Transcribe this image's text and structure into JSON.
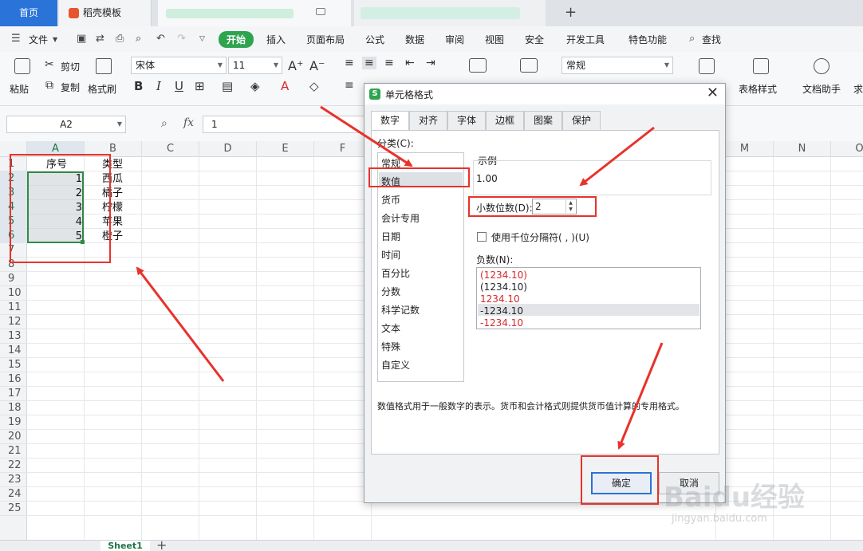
{
  "tabs": {
    "home": "首页",
    "template": "稻壳模板",
    "new_tab": "+"
  },
  "menu": {
    "file": "文件",
    "items": [
      "开始",
      "插入",
      "页面布局",
      "公式",
      "数据",
      "审阅",
      "视图",
      "安全",
      "开发工具",
      "特色功能",
      "查找"
    ]
  },
  "ribbon": {
    "paste": "粘贴",
    "cut": "剪切",
    "copy": "复制",
    "format_painter": "格式刷",
    "font_name": "宋体",
    "font_size": "11",
    "number_format": "常规",
    "table_style": "表格样式",
    "doc_helper": "文档助手",
    "more": "求"
  },
  "formula_bar": {
    "name_box": "A2",
    "fx": "fx",
    "value": "1"
  },
  "sheet": {
    "columns": [
      "A",
      "B",
      "C",
      "D",
      "E",
      "F",
      "M",
      "N",
      "O"
    ],
    "rows": [
      "1",
      "2",
      "3",
      "4",
      "5",
      "6",
      "7",
      "8",
      "9",
      "10",
      "11",
      "12",
      "13",
      "14",
      "15",
      "16",
      "17",
      "18",
      "19",
      "20",
      "21",
      "22",
      "23",
      "24",
      "25"
    ],
    "header": [
      "序号",
      "类型"
    ],
    "data": [
      {
        "no": "1",
        "type": "西瓜"
      },
      {
        "no": "2",
        "type": "橘子"
      },
      {
        "no": "3",
        "type": "柠檬"
      },
      {
        "no": "4",
        "type": "苹果"
      },
      {
        "no": "5",
        "type": "橙子"
      }
    ],
    "sheet_tab": "Sheet1"
  },
  "dialog": {
    "title": "单元格格式",
    "tabs": [
      "数字",
      "对齐",
      "字体",
      "边框",
      "图案",
      "保护"
    ],
    "category_label": "分类(C):",
    "categories": [
      "常规",
      "数值",
      "货币",
      "会计专用",
      "日期",
      "时间",
      "百分比",
      "分数",
      "科学记数",
      "文本",
      "特殊",
      "自定义"
    ],
    "selected_category": "数值",
    "sample_label": "示例",
    "sample_value": "1.00",
    "decimal_label": "小数位数(D):",
    "decimal_value": "2",
    "thousand_sep": "使用千位分隔符( , )(U)",
    "negative_label": "负数(N):",
    "negative_options": [
      "(1234.10)",
      "(1234.10)",
      "1234.10",
      "-1234.10",
      "-1234.10"
    ],
    "description": "数值格式用于一般数字的表示。货币和会计格式则提供货币值计算的专用格式。",
    "ok": "确定",
    "cancel": "取消"
  },
  "watermark": {
    "main": "Baidu经验",
    "sub": "jingyan.baidu.com"
  },
  "colors": {
    "accent": "#2a73d8",
    "start_green": "#2ea44f",
    "annotation_red": "#e8322b",
    "negative_red": "#d9262a"
  }
}
